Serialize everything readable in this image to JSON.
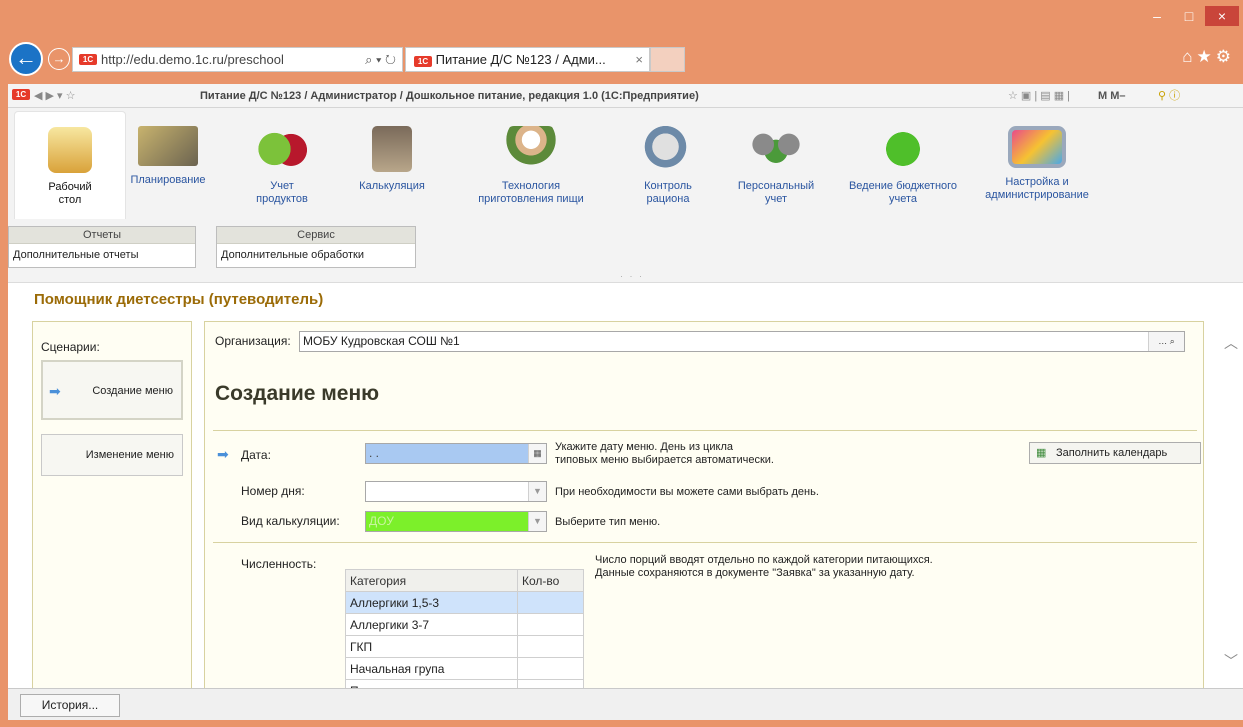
{
  "browser": {
    "url": "http://edu.demo.1c.ru/preschool",
    "tab_title": "Питание Д/С №123 / Адми...",
    "tab_close": "×",
    "win_min": "–",
    "win_max": "□",
    "win_close": "×",
    "toolbar_title": "Питание Д/С №123 / Администратор / Дошкольное питание, редакция 1.0  (1С:Предприятие)",
    "toolbar_right": "M  M–"
  },
  "sections": [
    {
      "label": "Рабочий стол",
      "icon": "desk-lamp-icon",
      "active": true
    },
    {
      "label": "Планирование",
      "icon": "drafting-tools-icon"
    },
    {
      "label": "Учет продуктов",
      "icon": "apples-icon"
    },
    {
      "label": "Калькуляция",
      "icon": "calculator-basket-icon"
    },
    {
      "label": "Технология приготовления пищи",
      "icon": "chef-icon"
    },
    {
      "label": "Контроль рациона",
      "icon": "lab-microscope-icon"
    },
    {
      "label": "Персональный учет",
      "icon": "people-icon"
    },
    {
      "label": "Ведение бюджетного учета",
      "icon": "home-icon"
    },
    {
      "label": "Настройка и администрирование",
      "icon": "monitor-settings-icon"
    }
  ],
  "groups": {
    "reports_header": "Отчеты",
    "reports_item": "Дополнительные отчеты",
    "service_header": "Сервис",
    "service_item": "Дополнительные обработки"
  },
  "page_title": "Помощник диетсестры (путеводитель)",
  "scenarios": {
    "label": "Сценарии:",
    "items": [
      "Создание меню",
      "Изменение меню"
    ]
  },
  "form": {
    "org_label": "Организация:",
    "org_value": "МОБУ Кудровская СОШ №1",
    "heading": "Создание меню",
    "date_label": "Дата:",
    "date_value": ". .",
    "date_hint_1": "Укажите дату меню. День из цикла",
    "date_hint_2": "типовых меню выбирается автоматически.",
    "fill_calendar": "Заполнить календарь",
    "day_label": "Номер дня:",
    "day_value": "",
    "day_hint": "При необходимости вы можете сами выбрать день.",
    "calc_label": "Вид калькуляции:",
    "calc_value": "ДОУ",
    "calc_hint": "Выберите тип меню.",
    "count_label": "Численность:",
    "count_hint_1": "Число порций вводят отдельно по каждой категории питающихся.",
    "count_hint_2": "Данные сохраняются в документе \"Заявка\" за указанную дату.",
    "table_headers": [
      "Категория",
      "Кол-во"
    ],
    "table_rows": [
      [
        "Аллергики 1,5-3",
        ""
      ],
      [
        "Аллергики 3-7",
        ""
      ],
      [
        "ГКП",
        ""
      ],
      [
        "Начальная група",
        ""
      ],
      [
        "Персонал",
        ""
      ]
    ]
  },
  "history_button": "История...",
  "colors": {
    "accent": "#9b6b07",
    "calc_fill": "#7cf02a",
    "date_fill": "#a9c9f2",
    "frame": "#e9946a"
  }
}
